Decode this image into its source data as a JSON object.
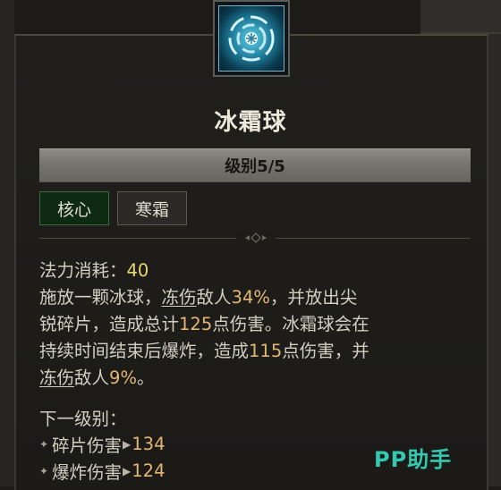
{
  "skill": {
    "name": "冰霜球",
    "icon": "frost-orb-icon",
    "level_label": "级别5/5",
    "tags": [
      "核心",
      "寒霜"
    ]
  },
  "description": {
    "mana_label": "法力消耗：",
    "mana_value": "40",
    "line1_a": "施放一颗冰球，",
    "line1_b": "冻伤",
    "line1_c": "敌人",
    "line1_d": "34%",
    "line1_e": "，并放出尖",
    "line2_a": "锐碎片，造成总计",
    "line2_b": "125",
    "line2_c": "点伤害。冰霜球会在",
    "line3_a": "持续时间结束后爆炸，造成",
    "line3_b": "115",
    "line3_c": "点伤害，并",
    "line4_a": "冻伤",
    "line4_b": "敌人",
    "line4_c": "9%",
    "line4_d": "。"
  },
  "next_level": {
    "label": "下一级别：",
    "items": [
      {
        "name": "碎片伤害",
        "value": "134"
      },
      {
        "name": "爆炸伤害",
        "value": "124"
      }
    ]
  },
  "watermark": "PP助手",
  "colors": {
    "accent_gold": "#e2b673",
    "mana_yellow": "#e7d86c",
    "core_tag_bg": "#0f2a12",
    "watermark_teal": "#33c9b0"
  }
}
